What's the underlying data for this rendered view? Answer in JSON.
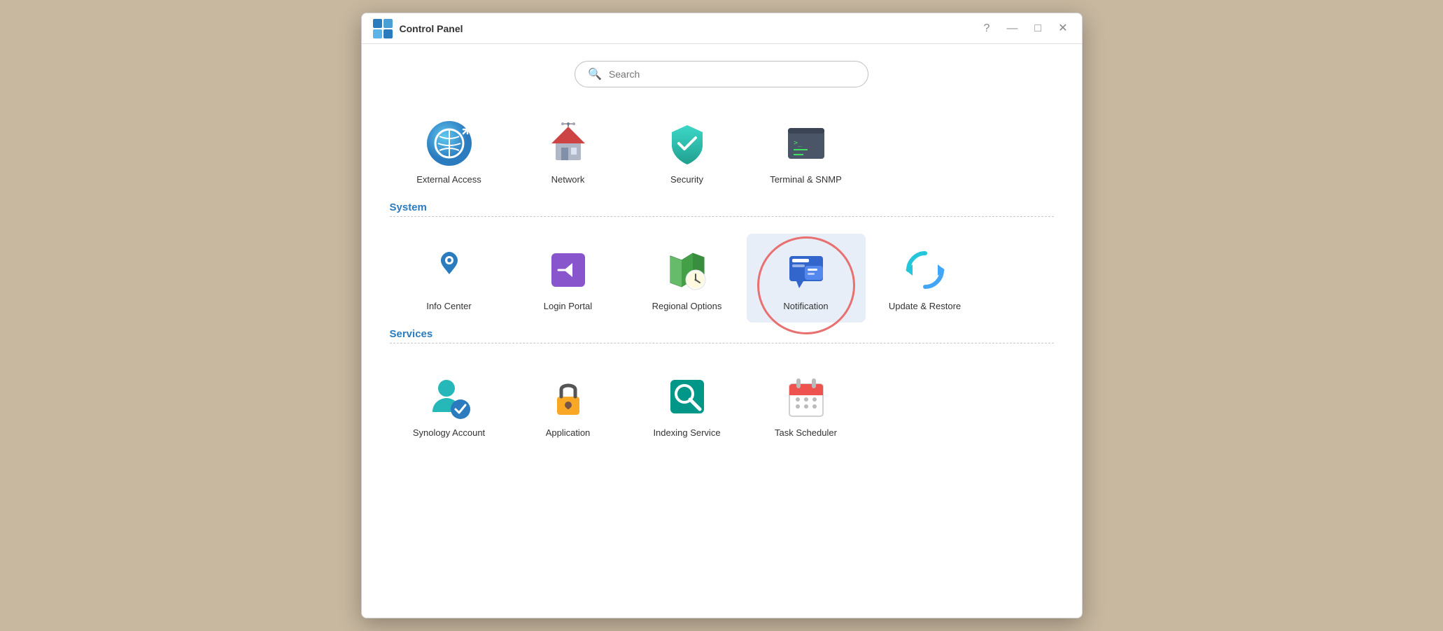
{
  "window": {
    "title": "Control Panel",
    "controls": {
      "help": "?",
      "minimize": "—",
      "maximize": "□",
      "close": "✕"
    }
  },
  "search": {
    "placeholder": "Search"
  },
  "connectivity_items": [
    {
      "id": "external-access",
      "label": "External Access"
    },
    {
      "id": "network",
      "label": "Network"
    },
    {
      "id": "security",
      "label": "Security"
    },
    {
      "id": "terminal-snmp",
      "label": "Terminal & SNMP"
    }
  ],
  "system": {
    "section_label": "System",
    "items": [
      {
        "id": "info-center",
        "label": "Info Center"
      },
      {
        "id": "login-portal",
        "label": "Login Portal"
      },
      {
        "id": "regional-options",
        "label": "Regional Options"
      },
      {
        "id": "notification",
        "label": "Notification",
        "highlighted": true
      },
      {
        "id": "update-restore",
        "label": "Update & Restore"
      }
    ]
  },
  "services": {
    "section_label": "Services",
    "items": [
      {
        "id": "synology-account",
        "label": "Synology Account"
      },
      {
        "id": "application",
        "label": "Application"
      },
      {
        "id": "indexing-service",
        "label": "Indexing Service"
      },
      {
        "id": "task-scheduler",
        "label": "Task Scheduler"
      }
    ]
  }
}
